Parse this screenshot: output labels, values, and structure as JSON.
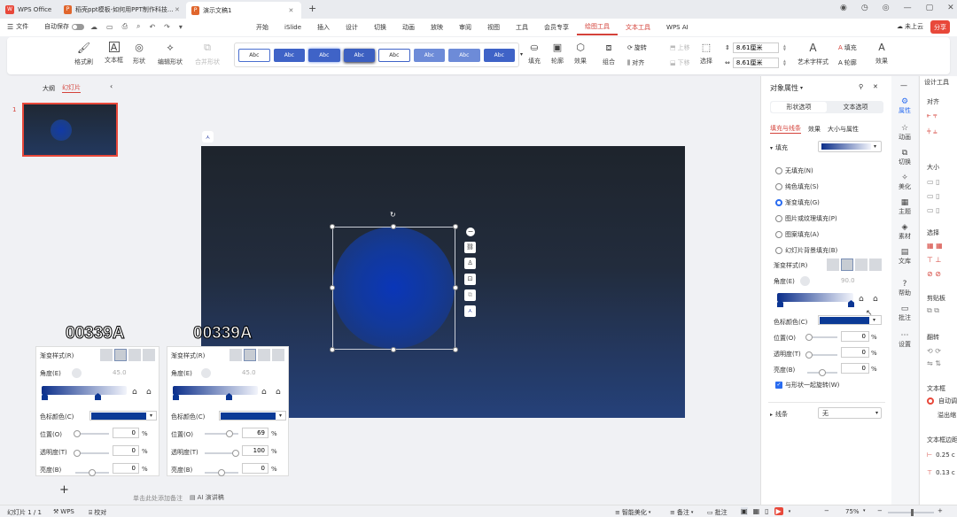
{
  "titlebar": {
    "tabs": [
      {
        "label": "WPS Office",
        "type": "wps"
      },
      {
        "label": "稻壳ppt模板-如何用PPT制作科技..."
      },
      {
        "label": "演示文稿1"
      }
    ],
    "new_tab": "+"
  },
  "menubar": {
    "file": "文件",
    "autosave": "自动保存",
    "tabs": [
      "开始",
      "iSlide",
      "插入",
      "设计",
      "切换",
      "动画",
      "放映",
      "审阅",
      "视图",
      "工具",
      "会员专享",
      "绘图工具",
      "文本工具",
      "WPS AI"
    ],
    "active_tab": "绘图工具",
    "cloud": "未上云",
    "share": "分享"
  },
  "ribbon": {
    "format_painter": "格式刷",
    "text_box": "文本框",
    "shape": "形状",
    "edit_shape": "编辑形状",
    "merge_shape": "合并形状",
    "styles": [
      "Abc",
      "Abc",
      "Abc",
      "Abc",
      "Abc",
      "Abc",
      "Abc",
      "Abc"
    ],
    "fill": "填充",
    "outline": "轮廓",
    "effects": "效果",
    "group": "组合",
    "rotate": "旋转",
    "align": "对齐",
    "up_layer": "上移",
    "down_layer": "下移",
    "select": "选择",
    "height": "8.61厘米",
    "width": "8.61厘米",
    "art_text": "艺术字样式",
    "text_fill": "填充",
    "text_outline": "轮廓",
    "text_effects": "效果"
  },
  "left_panel": {
    "outline_tab": "大纲",
    "slides_tab": "幻灯片",
    "slide_number": "1"
  },
  "canvas": {
    "notes_placeholder": "单击此处添加备注",
    "ai_notes": "AI 演讲稿"
  },
  "overlays": [
    {
      "hex": "00339A",
      "gradient_style": "渐变样式(R)",
      "angle_label": "角度(E)",
      "angle_value": "45.0",
      "stop_color_label": "色标颜色(C)",
      "position_label": "位置(O)",
      "position_value": "0",
      "transparency_label": "透明度(T)",
      "transparency_value": "0",
      "brightness_label": "亮度(B)",
      "brightness_value": "0",
      "unit": "%"
    },
    {
      "hex": "00339A",
      "gradient_style": "渐变样式(R)",
      "angle_label": "角度(E)",
      "angle_value": "45.0",
      "stop_color_label": "色标颜色(C)",
      "position_label": "位置(O)",
      "position_value": "69",
      "transparency_label": "透明度(T)",
      "transparency_value": "100",
      "brightness_label": "亮度(B)",
      "brightness_value": "0",
      "unit": "%"
    }
  ],
  "add_slide": "+",
  "props_panel": {
    "title": "对象属性",
    "tab_shape": "形状选项",
    "tab_text": "文本选项",
    "subtabs": [
      "填充与线条",
      "效果",
      "大小与属性"
    ],
    "fill_section": "填充",
    "fill_options": [
      "无填充(N)",
      "纯色填充(S)",
      "渐变填充(G)",
      "图片或纹理填充(P)",
      "图案填充(A)",
      "幻灯片背景填充(B)"
    ],
    "selected_fill": 2,
    "gradient_style": "渐变样式(R)",
    "angle_label": "角度(E)",
    "angle_value": "90.0",
    "stop_color_label": "色标颜色(C)",
    "position_label": "位置(O)",
    "position_value": "0",
    "transparency_label": "透明度(T)",
    "transparency_value": "0",
    "brightness_label": "亮度(B)",
    "brightness_value": "0",
    "unit": "%",
    "rotate_with_shape": "与形状一起旋转(W)",
    "line_section": "线条",
    "line_value": "无"
  },
  "side_tools": [
    "属性",
    "动画",
    "切换",
    "美化",
    "主题",
    "素材",
    "文库",
    "帮助",
    "批注",
    "设置"
  ],
  "far_right": {
    "title": "设计工具",
    "align": "对齐",
    "size": "大小",
    "select": "选择",
    "clipboard": "剪贴板",
    "rotate": "翻转",
    "textbox": "文本框",
    "autofit": "自动调整",
    "overflow": "溢出缩",
    "margin_title": "文本框边距",
    "margin1": "0.25 c",
    "margin2": "0.13 c"
  },
  "statusbar": {
    "slide_info": "幻灯片 1 / 1",
    "theme": "WPS",
    "proof": "校对",
    "smart": "智能美化",
    "notes": "备注",
    "comments": "批注",
    "zoom": "75%"
  },
  "colors": {
    "accent": "#2a6cf0",
    "wps_red": "#e8483a",
    "active_tab": "#d4423a",
    "dark_blue": "#00339A"
  }
}
